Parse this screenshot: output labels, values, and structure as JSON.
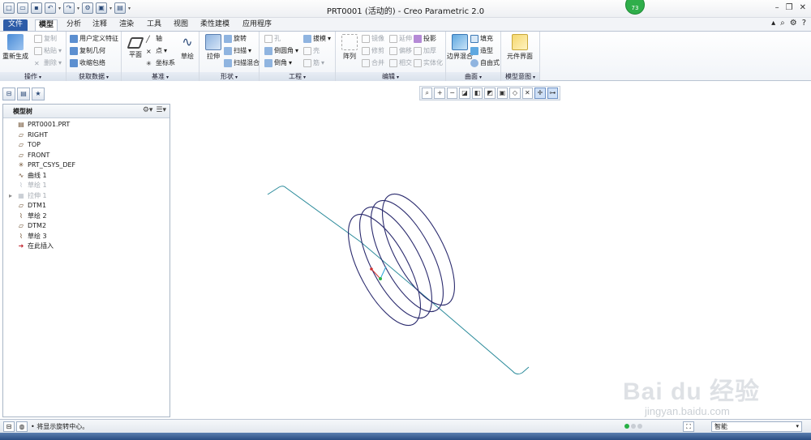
{
  "window": {
    "title": "PRT0001 (活动的) - Creo Parametric 2.0",
    "badge": "73"
  },
  "tabs": [
    "文件",
    "模型",
    "分析",
    "注释",
    "渲染",
    "工具",
    "视图",
    "柔性建模",
    "应用程序"
  ],
  "ribbon": {
    "operations": {
      "label": "操作",
      "regenerate": "重新生成",
      "copy": "复制",
      "paste": "粘贴",
      "delete": "删除"
    },
    "get_data": {
      "label": "获取数据",
      "udf": "用户定义特征",
      "copy_geom": "复制几何",
      "shrinkwrap": "收缩包络"
    },
    "datum": {
      "label": "基准",
      "plane": "平面",
      "axis": "轴",
      "point": "点",
      "csys": "坐标系",
      "sketch": "草绘"
    },
    "shapes": {
      "label": "形状",
      "extrude": "拉伸",
      "revolve": "旋转",
      "sweep": "扫描",
      "swept_blend": "扫描混合"
    },
    "engineering": {
      "label": "工程",
      "hole": "孔",
      "round": "倒圆角",
      "chamfer": "倒角",
      "draft": "拔模",
      "shell": "壳",
      "rib": "筋"
    },
    "editing": {
      "label": "编辑",
      "pattern": "阵列",
      "mirror": "镜像",
      "extend": "延伸",
      "project": "投影",
      "trim": "修剪",
      "offset": "偏移",
      "thicken": "加厚",
      "merge": "合并",
      "intersect": "相交",
      "solidify": "实体化"
    },
    "surfaces": {
      "label": "曲面",
      "boundary_blend": "边界混合",
      "fill": "填充",
      "style": "造型",
      "freestyle": "自由式"
    },
    "model_intent": {
      "label": "模型意图",
      "component_interface": "元件界面"
    }
  },
  "model_tree": {
    "title": "模型树",
    "items": [
      {
        "label": "PRT0001.PRT",
        "icon": "part-icon",
        "dim": false,
        "expand": false
      },
      {
        "label": "RIGHT",
        "icon": "datum-plane-icon",
        "dim": false,
        "expand": false
      },
      {
        "label": "TOP",
        "icon": "datum-plane-icon",
        "dim": false,
        "expand": false
      },
      {
        "label": "FRONT",
        "icon": "datum-plane-icon",
        "dim": false,
        "expand": false
      },
      {
        "label": "PRT_CSYS_DEF",
        "icon": "csys-icon",
        "dim": false,
        "expand": false
      },
      {
        "label": "曲线 1",
        "icon": "curve-icon",
        "dim": false,
        "expand": false
      },
      {
        "label": "草绘 1",
        "icon": "sketch-icon",
        "dim": true,
        "expand": false
      },
      {
        "label": "拉伸 1",
        "icon": "extrude-icon",
        "dim": true,
        "expand": true
      },
      {
        "label": "DTM1",
        "icon": "datum-plane-icon",
        "dim": false,
        "expand": false
      },
      {
        "label": "草绘 2",
        "icon": "sketch-icon",
        "dim": false,
        "expand": false
      },
      {
        "label": "DTM2",
        "icon": "datum-plane-icon",
        "dim": false,
        "expand": false
      },
      {
        "label": "草绘 3",
        "icon": "sketch-icon",
        "dim": false,
        "expand": false
      },
      {
        "label": "在此插入",
        "icon": "insert-arrow-icon",
        "dim": false,
        "expand": false
      }
    ]
  },
  "status": {
    "message": "将显示旋转中心。",
    "filter_value": "智能"
  },
  "watermark": {
    "text": "Bai du 经验",
    "sub": "jingyan.baidu.com"
  },
  "colors": {
    "curve": "#2a8a9a",
    "coil": "#2b2b6e",
    "accent": "#2d5ca8"
  }
}
